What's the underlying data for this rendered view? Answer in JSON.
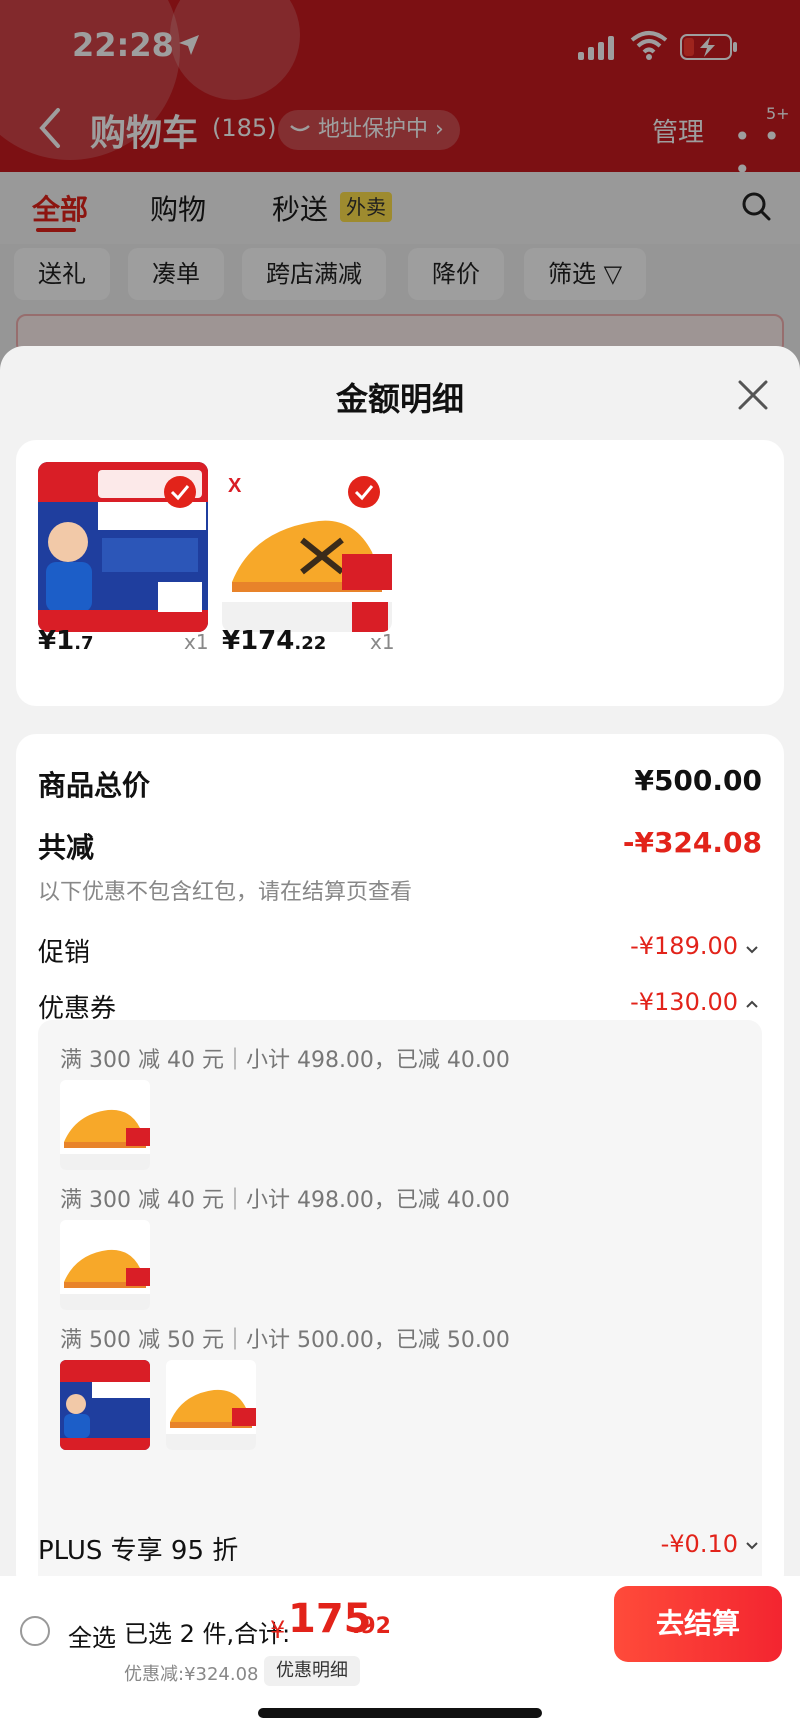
{
  "status_bar": {
    "time": "22:28"
  },
  "nav": {
    "title": "购物车",
    "count": "(185)",
    "address_pill": "地址保护中 ›",
    "manage": "管理",
    "more": "• • •",
    "badge": "5+"
  },
  "tabs": [
    {
      "label": "全部",
      "active": true
    },
    {
      "label": "购物",
      "active": false
    },
    {
      "label": "秒送",
      "active": false
    }
  ],
  "waimai_tag": "外卖",
  "filter_chips": [
    "送礼",
    "凑单",
    "跨店满减",
    "降价",
    "筛选 ▽"
  ],
  "sheet": {
    "title": "金额明细",
    "products": [
      {
        "price_int": "¥1",
        "price_dec": ".7",
        "qty": "x1",
        "thumb": "collagen-product",
        "checked": true
      },
      {
        "price_int": "¥174",
        "price_dec": ".22",
        "qty": "x1",
        "thumb": "orange-running-shoe",
        "checked": true
      }
    ],
    "summary": {
      "total_label": "商品总价",
      "total_value": "¥500.00",
      "reduce_label": "共减",
      "reduce_value": "-¥324.08",
      "note": "以下优惠不包含红包，请在结算页查看",
      "promo_label": "促销",
      "promo_value": "-¥189.00",
      "coupon_label": "优惠券",
      "coupon_value": "-¥130.00",
      "plus_label": "PLUS 专享 95 折",
      "plus_value": "-¥0.10"
    },
    "coupon_lines": [
      "满 300 减 40 元｜小计 498.00，已减 40.00",
      "满 300 减 40 元｜小计 498.00，已减 40.00",
      "满 500 减 50 元｜小计 500.00，已减 50.00"
    ]
  },
  "bottom_bar": {
    "select_all": "全选",
    "selected": "已选 2 件,合计:",
    "currency": "¥",
    "total_int": "175",
    "total_dec": ".92",
    "discount": "优惠减:¥324.08",
    "detail_link": "优惠明细",
    "checkout": "去结算"
  },
  "colors": {
    "brand_red": "#e2231a",
    "header_red": "#c81a1f",
    "shoe_orange": "#f7a829"
  }
}
